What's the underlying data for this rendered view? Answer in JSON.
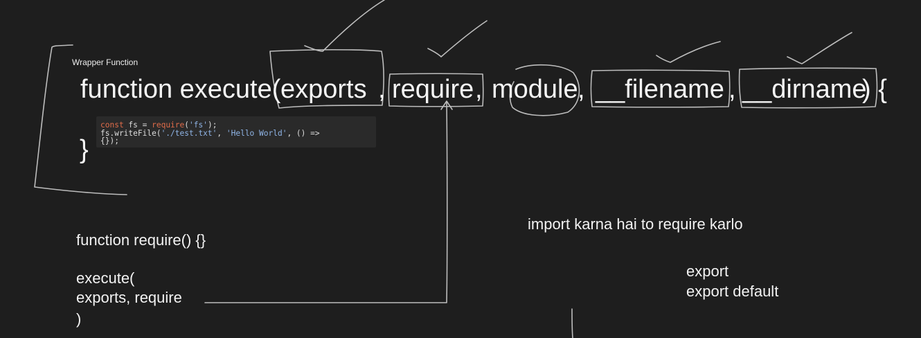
{
  "wrapper_label": "Wrapper Function",
  "signature": {
    "prefix": "function execute(",
    "exports": "exports",
    "sep1": ",",
    "require": "require",
    "sep2": ",",
    "module": "module",
    "sep3": ",",
    "filename": "__filename",
    "sep4": ",",
    "dirname": "__dirname",
    "suffix": ") {"
  },
  "closing_brace": "}",
  "code": {
    "l1_kw": "const",
    "l1_var": " fs = ",
    "l1_fn": "require",
    "l1_open": "(",
    "l1_str": "'fs'",
    "l1_end": ");",
    "l2_a": "fs.writeFile(",
    "l2_str1": "'./test.txt'",
    "l2_b": ", ",
    "l2_str2": "'Hello World'",
    "l2_c": ", () =>",
    "l3": "{});"
  },
  "notes": {
    "require_def": "function require() {}",
    "execute_call_1": "execute(",
    "execute_call_2": "exports, require",
    "execute_call_3": ")",
    "import_note": "import karna hai to require karlo",
    "export_1": "export",
    "export_2": "export default"
  },
  "colors": {
    "background": "#1e1e1e",
    "stroke": "#bdbdbd",
    "code_bg": "#2a2a2a",
    "keyword": "#e06c4a",
    "string": "#8fb4e6"
  }
}
